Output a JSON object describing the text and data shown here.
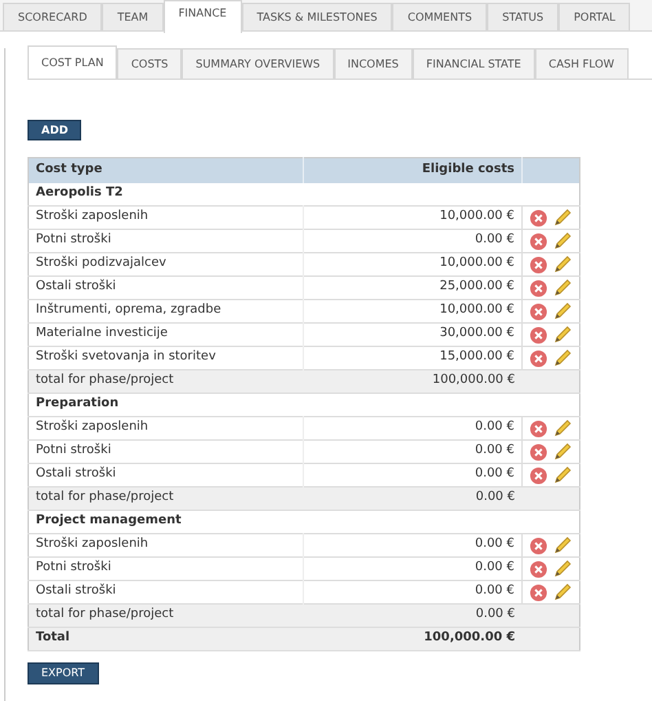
{
  "main_tabs": [
    {
      "label": "SCORECARD",
      "selected": false
    },
    {
      "label": "TEAM",
      "selected": false
    },
    {
      "label": "FINANCE",
      "selected": true
    },
    {
      "label": "TASKS & MILESTONES",
      "selected": false
    },
    {
      "label": "COMMENTS",
      "selected": false
    },
    {
      "label": "STATUS",
      "selected": false
    },
    {
      "label": "PORTAL",
      "selected": false
    }
  ],
  "sub_tabs": [
    {
      "label": "COST PLAN",
      "selected": true
    },
    {
      "label": "COSTS",
      "selected": false
    },
    {
      "label": "SUMMARY OVERVIEWS",
      "selected": false
    },
    {
      "label": "INCOMES",
      "selected": false
    },
    {
      "label": "FINANCIAL STATE",
      "selected": false
    },
    {
      "label": "CASH FLOW",
      "selected": false
    }
  ],
  "add_button": "ADD",
  "table": {
    "columns": [
      "Cost type",
      "Eligible costs"
    ],
    "rows": [
      {
        "kind": "group",
        "label": "Aeropolis T2"
      },
      {
        "kind": "item",
        "label": "Stroški zaposlenih",
        "amount": "10,000.00 €"
      },
      {
        "kind": "item",
        "label": "Potni stroški",
        "amount": "0.00 €"
      },
      {
        "kind": "item",
        "label": "Stroški podizvajalcev",
        "amount": "10,000.00 €"
      },
      {
        "kind": "item",
        "label": "Ostali stroški",
        "amount": "25,000.00 €"
      },
      {
        "kind": "item",
        "label": "Inštrumenti, oprema, zgradbe",
        "amount": "10,000.00 €"
      },
      {
        "kind": "item",
        "label": "Materialne investicije",
        "amount": "30,000.00 €"
      },
      {
        "kind": "item",
        "label": "Stroški svetovanja in storitev",
        "amount": "15,000.00 €"
      },
      {
        "kind": "subtotal",
        "label": "total for phase/project",
        "amount": "100,000.00 €"
      },
      {
        "kind": "group",
        "label": "Preparation"
      },
      {
        "kind": "item",
        "label": "Stroški zaposlenih",
        "amount": "0.00 €"
      },
      {
        "kind": "item",
        "label": "Potni stroški",
        "amount": "0.00 €"
      },
      {
        "kind": "item",
        "label": "Ostali stroški",
        "amount": "0.00 €"
      },
      {
        "kind": "subtotal",
        "label": "total for phase/project",
        "amount": "0.00 €"
      },
      {
        "kind": "group",
        "label": "Project management"
      },
      {
        "kind": "item",
        "label": "Stroški zaposlenih",
        "amount": "0.00 €"
      },
      {
        "kind": "item",
        "label": "Potni stroški",
        "amount": "0.00 €"
      },
      {
        "kind": "item",
        "label": "Ostali stroški",
        "amount": "0.00 €"
      },
      {
        "kind": "subtotal",
        "label": "total for phase/project",
        "amount": "0.00 €"
      },
      {
        "kind": "total",
        "label": "Total",
        "amount": "100,000.00 €"
      }
    ]
  },
  "export_button": "EXPORT"
}
